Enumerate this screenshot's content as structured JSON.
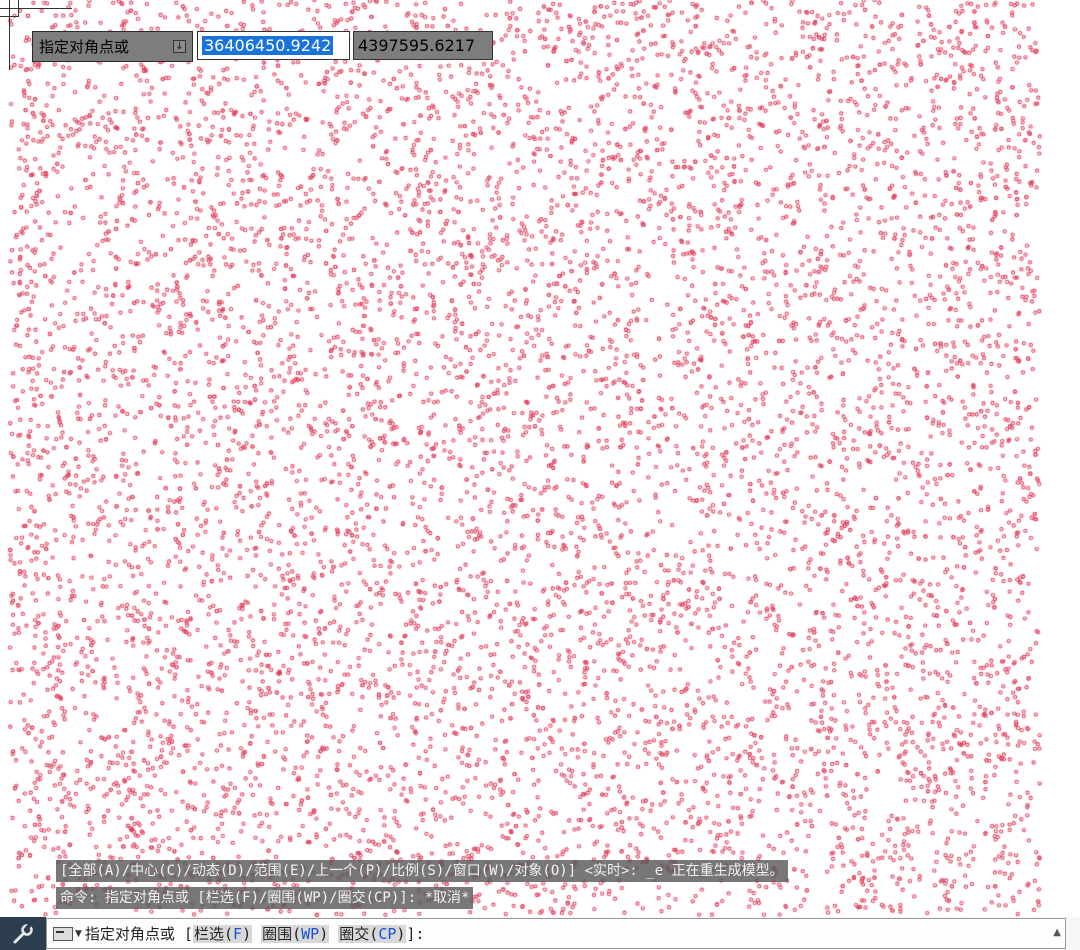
{
  "dynamic_input": {
    "prompt": "指定对角点或",
    "x_value": "36406450.9242",
    "y_value": "4397595.6217"
  },
  "history": {
    "line1": "[全部(A)/中心(C)/动态(D)/范围(E)/上一个(P)/比例(S)/窗口(W)/对象(O)] <实时>: _e 正在重生成模型。",
    "line2": "命令: 指定对角点或 [栏选(F)/圈围(WP)/圈交(CP)]: *取消*"
  },
  "command_line": {
    "prompt": "指定对角点或",
    "bracket_open": "[",
    "opt1_label": "栏选(",
    "opt1_key": "F",
    "opt1_close": ")",
    "opt2_label": "圈围(",
    "opt2_key": "WP",
    "opt2_close": ")",
    "opt3_label": "圈交(",
    "opt3_key": "CP",
    "opt3_close": ")",
    "bracket_close": "]:"
  },
  "colors": {
    "point_marker": "#e0435f",
    "background": "#ffffff",
    "option_key": "#1a4fd6"
  },
  "icons": [
    "wrench-icon",
    "command-line-icon",
    "dropdown-arrow-icon",
    "scroll-up-icon"
  ]
}
